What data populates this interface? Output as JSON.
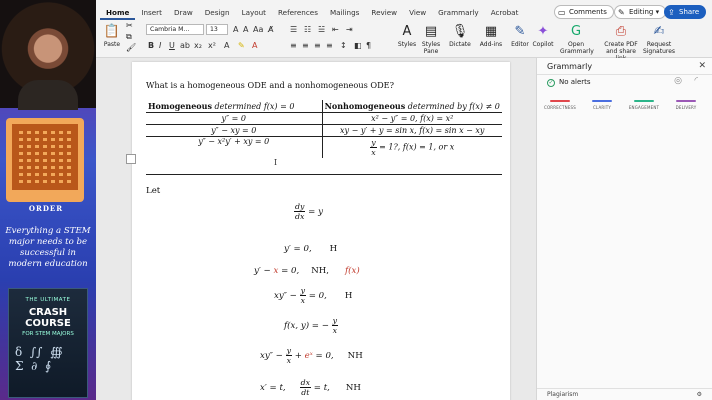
{
  "ribbon": {
    "tabs": [
      "Home",
      "Insert",
      "Draw",
      "Design",
      "Layout",
      "References",
      "Mailings",
      "Review",
      "View",
      "Grammarly",
      "Acrobat"
    ],
    "active_tab": "Home",
    "comments_label": "Comments",
    "editing_label": "Editing",
    "share_label": "Share",
    "paste_label": "Paste",
    "font_name": "Cambria M...",
    "font_size": "13",
    "tools": [
      {
        "label": "Styles",
        "icon": "styles-icon"
      },
      {
        "label": "Styles Pane",
        "icon": "styles-pane-icon"
      },
      {
        "label": "Dictate",
        "icon": "microphone-icon"
      },
      {
        "label": "Add-ins",
        "icon": "add-ins-icon"
      },
      {
        "label": "Editor",
        "icon": "editor-icon"
      },
      {
        "label": "Copilot",
        "icon": "copilot-icon"
      },
      {
        "label": "Open Grammarly",
        "icon": "grammarly-icon"
      },
      {
        "label": "Create PDF and share link",
        "icon": "pdf-icon"
      },
      {
        "label": "Request Signatures",
        "icon": "signature-icon"
      }
    ]
  },
  "document": {
    "question": "What is a homogeneous ODE and a nonhomogeneous ODE?",
    "table": {
      "header_left_bold": "Homogeneous",
      "header_left_rest": " determined f(x) = 0",
      "header_right_bold": "Nonhomogeneous",
      "header_right_rest": " determined by f(x) ≠ 0",
      "rows": [
        {
          "left": "y″ = 0",
          "right": "x² − y″ = 0,     f(x) = x²"
        },
        {
          "left": "y″ − xy = 0",
          "right": "xy − y′ + y = sin x,     f(x) = sin x − xy"
        },
        {
          "left": "y″ − x²y′ + xy = 0",
          "right_frac_num": "y",
          "right_frac_den": "x",
          "right": " = 1?,     f(x) = 1, or x"
        }
      ]
    },
    "let_label": "Let",
    "eq1_num": "dy",
    "eq1_den": "dx",
    "eq1_rest": " = y",
    "eq2": "y′ = 0,",
    "eq2_tag": "H",
    "eq3_a": "y′ − ",
    "eq3_red": "x",
    "eq3_b": " = 0,",
    "eq3_tag": "NH,",
    "eq3_f": "f(x)",
    "eq4_a": "xy″ − ",
    "eq4_num": "y",
    "eq4_den": "x",
    "eq4_b": " = 0,",
    "eq4_tag": "H",
    "eq5_a": "f(x, y) = − ",
    "eq5_num": "y",
    "eq5_den": "x",
    "eq6_a": "xy″ − ",
    "eq6_num": "y",
    "eq6_den": "x",
    "eq6_b": " + ",
    "eq6_red": "eˣ",
    "eq6_c": " = 0,",
    "eq6_tag": "NH",
    "eq7_a": "x′ = t,",
    "eq7_num": "dx",
    "eq7_den": "dt",
    "eq7_b": " = t,",
    "eq7_tag": "NH"
  },
  "grammarly": {
    "title": "Grammarly",
    "alerts": "No alerts",
    "categories": [
      {
        "label": "CORRECTNESS",
        "color": "#e0474c"
      },
      {
        "label": "CLARITY",
        "color": "#4a6ee0"
      },
      {
        "label": "ENGAGEMENT",
        "color": "#2cb58a"
      },
      {
        "label": "DELIVERY",
        "color": "#9b59b6"
      }
    ],
    "bottom": "Plagiarism"
  },
  "sidebar": {
    "order_label": "ORDER",
    "promo_text": "Everything a STEM major needs to be successful in modern education",
    "book_top": "THE ULTIMATE",
    "book_title": "CRASH COURSE",
    "book_sub": "FOR STEM MAJORS"
  }
}
